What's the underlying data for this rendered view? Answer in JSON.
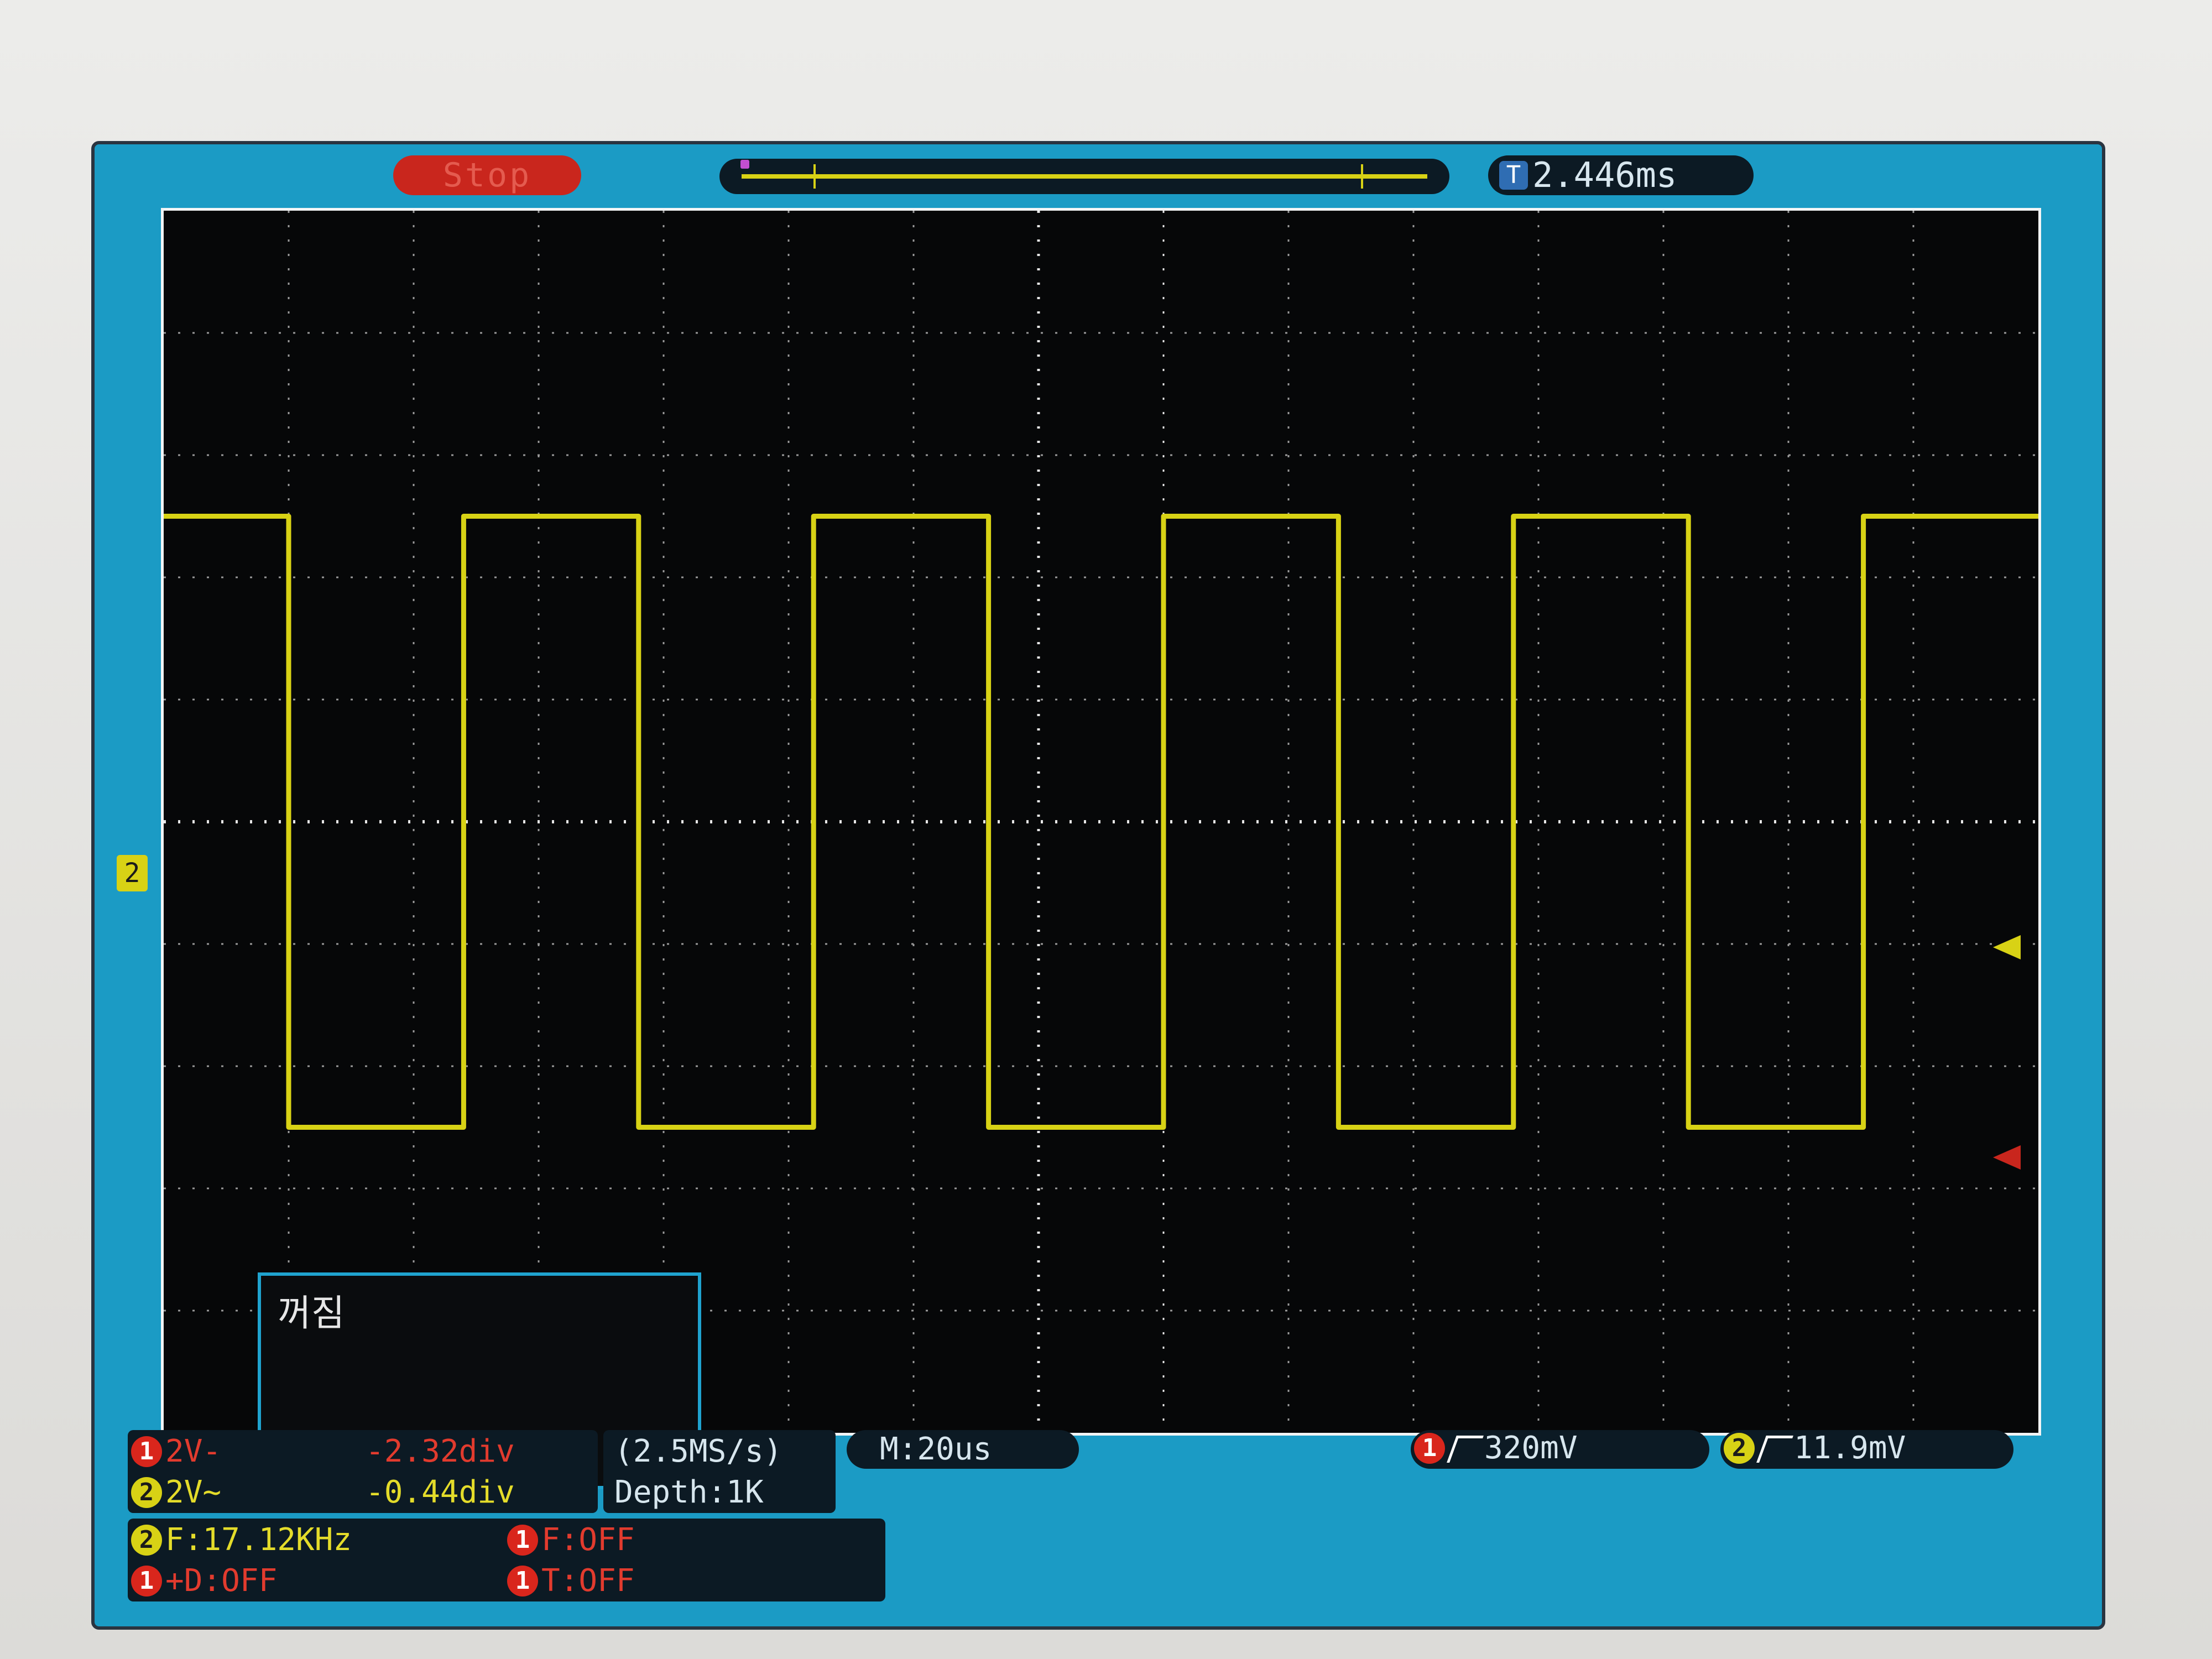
{
  "top_bar": {
    "run_status": "Stop",
    "trigger_time": "2.446ms"
  },
  "plot": {
    "channel_marker": "2",
    "menu_title": "꺼짐"
  },
  "channels": [
    {
      "id": "1",
      "scale": "2V-",
      "offset": "-2.32div",
      "color": "#d9261c"
    },
    {
      "id": "2",
      "scale": "2V~",
      "offset": "-0.44div",
      "color": "#d8d215"
    }
  ],
  "acquisition": {
    "sample_rate": "(2.5MS/s)",
    "depth": "Depth:1K"
  },
  "timebase": "M:20us",
  "trigger": [
    {
      "channel": "1",
      "level": "320mV"
    },
    {
      "channel": "2",
      "level": "11.9mV"
    }
  ],
  "measurements": {
    "frequency": {
      "channel": "2",
      "text": "F:17.12KHz"
    },
    "delta": {
      "channel": "1",
      "text": "+D:OFF"
    },
    "f_status": {
      "channel": "1",
      "text": "F:OFF"
    },
    "t_status": {
      "channel": "1",
      "text": "T:OFF"
    }
  },
  "icons": [
    "trigger-time-icon",
    "channel-badge-icon",
    "rising-edge-icon",
    "trigger-level-marker-icon"
  ],
  "colors": {
    "screen_bg": "#1b9bc5",
    "trace": "#d8d215",
    "stop": "#c9261d"
  },
  "chart_data": {
    "type": "line",
    "series": [
      {
        "name": "2",
        "x": [
          0,
          5,
          5,
          12,
          12,
          19,
          19,
          26,
          26,
          33,
          33,
          40,
          40,
          47,
          47,
          54,
          54,
          61,
          61,
          68,
          68,
          75,
          75
        ],
        "values": [
          1,
          1,
          0,
          0,
          1,
          1,
          0,
          0,
          1,
          1,
          0,
          0,
          1,
          1,
          0,
          0,
          1,
          1,
          0,
          0,
          1,
          1,
          1
        ]
      }
    ],
    "xlim": [
      0,
      75
    ],
    "ylim": [
      -0.5,
      1.5
    ],
    "grid": true
  }
}
